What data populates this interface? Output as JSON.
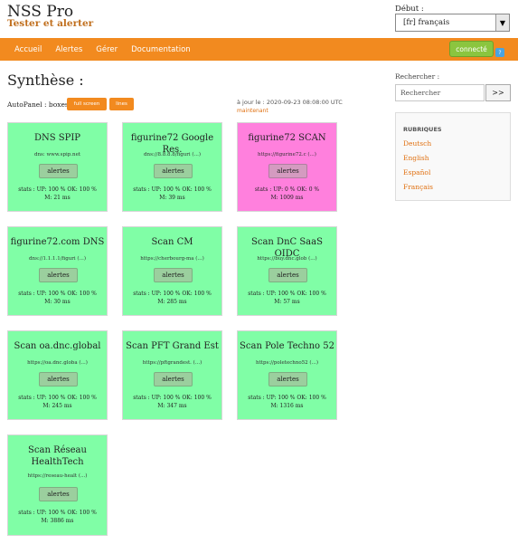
{
  "header": {
    "site_title": "NSS Pro",
    "slogan": "Tester et alerter",
    "lang_label": "Début :",
    "lang_selected": "[fr] français"
  },
  "nav": {
    "items": [
      "Accueil",
      "Alertes",
      "Gérer",
      "Documentation"
    ],
    "connect_label": "connecté",
    "help_badge": "?"
  },
  "main": {
    "title": "Synthèse :",
    "autopanel_label": "AutoPanel : boxes",
    "fullscreen_label": "full screen",
    "lines_label": "lines",
    "update_text": "à jour le : 2020-09-23 08:08:00 UTC",
    "update_now": "maintenant"
  },
  "cards": [
    {
      "title": "DNS SPIP",
      "url": "dns: www.spip.net",
      "button": "alertes",
      "stats1": "stats : UP: 100 % OK: 100 %",
      "stats2": "M: 21 ms",
      "status": "ok"
    },
    {
      "title": "figurine72 Google Res.",
      "url": "dns://8.8.8.8/figuri (...)",
      "button": "alertes",
      "stats1": "stats : UP: 100 % OK: 100 %",
      "stats2": "M: 39 ms",
      "status": "ok"
    },
    {
      "title": "figurine72 SCAN",
      "url": "https://figurine72.c (...)",
      "button": "alertes",
      "stats1": "stats : UP: 0 % OK: 0 %",
      "stats2": "M: 1009 ms",
      "status": "alert"
    },
    {
      "title": "figurine72.com DNS",
      "url": "dns://1.1.1.1/figuri (...)",
      "button": "alertes",
      "stats1": "stats : UP: 100 % OK: 100 %",
      "stats2": "M: 30 ms",
      "status": "ok"
    },
    {
      "title": "Scan CM",
      "url": "https://cherbourg-ma (...)",
      "button": "alertes",
      "stats1": "stats : UP: 100 % OK: 100 %",
      "stats2": "M: 285 ms",
      "status": "ok"
    },
    {
      "title": "Scan DnC SaaS OIDC",
      "url": "https://buy.dnc.glob (...)",
      "button": "alertes",
      "stats1": "stats : UP: 100 % OK: 100 %",
      "stats2": "M: 57 ms",
      "status": "ok"
    },
    {
      "title": "Scan oa.dnc.global",
      "url": "https://oa.dnc.globa (...)",
      "button": "alertes",
      "stats1": "stats : UP: 100 % OK: 100 %",
      "stats2": "M: 245 ms",
      "status": "ok"
    },
    {
      "title": "Scan PFT Grand Est",
      "url": "https://pftgrandest. (...)",
      "button": "alertes",
      "stats1": "stats : UP: 100 % OK: 100 %",
      "stats2": "M: 347 ms",
      "status": "ok"
    },
    {
      "title": "Scan Pole Techno 52",
      "url": "https://poletechno52 (...)",
      "button": "alertes",
      "stats1": "stats : UP: 100 % OK: 100 %",
      "stats2": "M: 1316 ms",
      "status": "ok"
    },
    {
      "title": "Scan Réseau HealthTech",
      "url": "https://reseau-healt (...)",
      "button": "alertes",
      "stats1": "stats : UP: 100 % OK: 100 %",
      "stats2": "M: 3886 ms",
      "status": "ok"
    }
  ],
  "sidebar": {
    "search_label": "Rechercher :",
    "search_placeholder": "Rechercher",
    "search_button": ">>",
    "rubriques_title": "RUBRIQUES",
    "rubriques": [
      "Deutsch",
      "English",
      "Español",
      "Français"
    ]
  }
}
